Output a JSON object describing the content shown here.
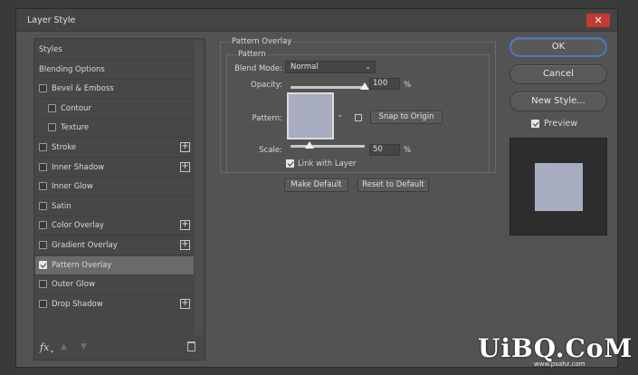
{
  "window": {
    "title": "Layer Style",
    "close_glyph": "✕"
  },
  "styles_list": {
    "items": [
      {
        "label": "Styles",
        "checkbox": false,
        "checked": false,
        "indent": 0,
        "plus": false,
        "selected": false
      },
      {
        "label": "Blending Options",
        "checkbox": false,
        "checked": false,
        "indent": 0,
        "plus": false,
        "selected": false
      },
      {
        "label": "Bevel & Emboss",
        "checkbox": true,
        "checked": false,
        "indent": 0,
        "plus": false,
        "selected": false
      },
      {
        "label": "Contour",
        "checkbox": true,
        "checked": false,
        "indent": 1,
        "plus": false,
        "selected": false
      },
      {
        "label": "Texture",
        "checkbox": true,
        "checked": false,
        "indent": 1,
        "plus": false,
        "selected": false
      },
      {
        "label": "Stroke",
        "checkbox": true,
        "checked": false,
        "indent": 0,
        "plus": true,
        "selected": false
      },
      {
        "label": "Inner Shadow",
        "checkbox": true,
        "checked": false,
        "indent": 0,
        "plus": true,
        "selected": false
      },
      {
        "label": "Inner Glow",
        "checkbox": true,
        "checked": false,
        "indent": 0,
        "plus": false,
        "selected": false
      },
      {
        "label": "Satin",
        "checkbox": true,
        "checked": false,
        "indent": 0,
        "plus": false,
        "selected": false
      },
      {
        "label": "Color Overlay",
        "checkbox": true,
        "checked": false,
        "indent": 0,
        "plus": true,
        "selected": false
      },
      {
        "label": "Gradient Overlay",
        "checkbox": true,
        "checked": false,
        "indent": 0,
        "plus": true,
        "selected": false
      },
      {
        "label": "Pattern Overlay",
        "checkbox": true,
        "checked": true,
        "indent": 0,
        "plus": false,
        "selected": true
      },
      {
        "label": "Outer Glow",
        "checkbox": true,
        "checked": false,
        "indent": 0,
        "plus": false,
        "selected": false
      },
      {
        "label": "Drop Shadow",
        "checkbox": true,
        "checked": false,
        "indent": 0,
        "plus": true,
        "selected": false
      }
    ],
    "footer": {
      "fx_label": "fx",
      "fx_caret": "▾",
      "up_glyph": "▲",
      "down_glyph": "▼"
    }
  },
  "pattern_overlay": {
    "group_title": "Pattern Overlay",
    "sub_group_title": "Pattern",
    "blend_mode_label": "Blend Mode:",
    "blend_mode_value": "Normal",
    "dropdown_glyph": "⌄",
    "opacity_label": "Opacity:",
    "opacity_value": "100",
    "opacity_fraction": 1.0,
    "opacity_unit": "%",
    "pattern_label": "Pattern:",
    "pattern_dropdown_glyph": "⌄",
    "snap_button": "Snap to Origin",
    "scale_label": "Scale:",
    "scale_value": "50",
    "scale_fraction": 0.25,
    "scale_unit": "%",
    "link_label": "Link with Layer",
    "link_checked": true,
    "make_default_button": "Make Default",
    "reset_default_button": "Reset to Default"
  },
  "right_panel": {
    "ok_button": "OK",
    "cancel_button": "Cancel",
    "new_style_button": "New Style...",
    "preview_label": "Preview",
    "preview_checked": true
  },
  "colors": {
    "dialog_bg": "#535353",
    "accent_blue": "#4a78c2",
    "close_red": "#c43a31",
    "pattern_lavender": "#a9adc2"
  },
  "watermark": {
    "text": "UiBQ.CoM",
    "sub": "www.psahz.com"
  }
}
